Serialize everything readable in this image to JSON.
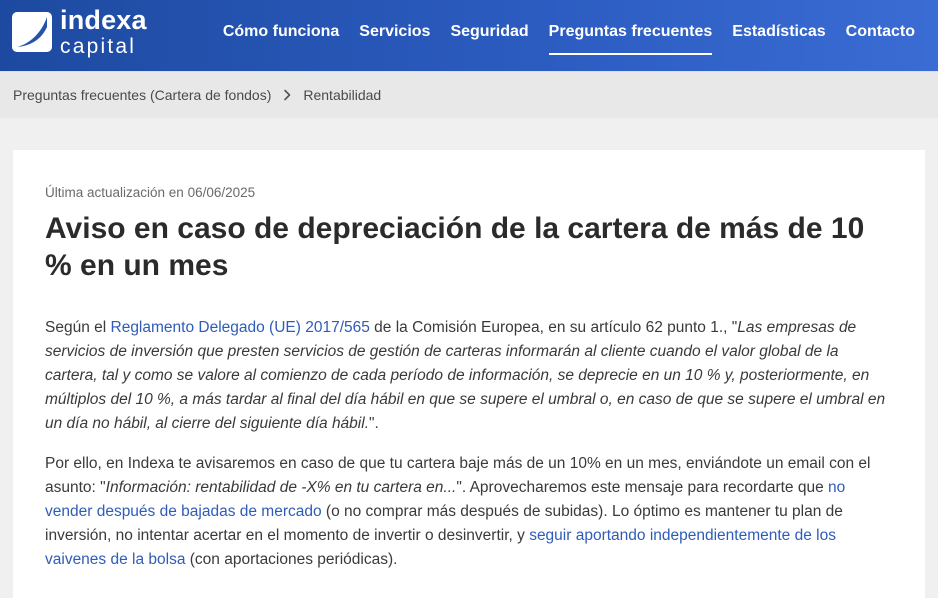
{
  "colors": {
    "header_start": "#1d4aa0",
    "header_mid": "#2b5bbf",
    "header_end": "#3a6cd4",
    "link": "#2e5cb8",
    "text": "#3a3a3a",
    "page_bg": "#f0f0f0",
    "breadcrumb_bg": "#e8e8e8"
  },
  "icons": {
    "logo": "indexa-logo-icon",
    "breadcrumb_separator": "chevron-right-icon"
  },
  "header": {
    "logo": {
      "line1": "indexa",
      "line2": "capital"
    },
    "nav": [
      {
        "label": "Cómo funciona",
        "active": false
      },
      {
        "label": "Servicios",
        "active": false
      },
      {
        "label": "Seguridad",
        "active": false
      },
      {
        "label": "Preguntas frecuentes",
        "active": true
      },
      {
        "label": "Estadísticas",
        "active": false
      },
      {
        "label": "Contacto",
        "active": false
      }
    ]
  },
  "breadcrumb": {
    "items": [
      "Preguntas frecuentes (Cartera de fondos)",
      "Rentabilidad"
    ]
  },
  "article": {
    "updated": "Última actualización en 06/06/2025",
    "title": "Aviso en caso de depreciación de la cartera de más de 10 % en un mes",
    "p1": [
      {
        "type": "text",
        "text": "Según el "
      },
      {
        "type": "link",
        "text": "Reglamento Delegado (UE) 2017/565"
      },
      {
        "type": "text",
        "text": " de la Comisión Europea, en su artículo 62 punto 1., \""
      },
      {
        "type": "italic",
        "text": "Las empresas de servicios de inversión que presten servicios de gestión de carteras informarán al cliente cuando el valor global de la cartera, tal y como se valore al comienzo de cada período de información, se deprecie en un 10 % y, posteriormente, en múltiplos del 10 %, a más tardar al final del día hábil en que se supere el umbral o, en caso de que se supere el umbral en un día no hábil, al cierre del siguiente día hábil."
      },
      {
        "type": "text",
        "text": "\"."
      }
    ],
    "p2": [
      {
        "type": "text",
        "text": "Por ello, en Indexa te avisaremos en caso de que tu cartera baje más de un 10% en un mes, enviándote un email con el asunto: \""
      },
      {
        "type": "italic",
        "text": "Información: rentabilidad de -X% en tu cartera en..."
      },
      {
        "type": "text",
        "text": "\". Aprovecharemos este mensaje para recordarte que "
      },
      {
        "type": "link",
        "text": "no vender después de bajadas de mercado"
      },
      {
        "type": "text",
        "text": " (o no comprar más después de subidas). Lo óptimo es mantener tu plan de inversión, no intentar acertar en el momento de invertir o desinvertir, y "
      },
      {
        "type": "link",
        "text": "seguir aportando independientemente de los vaivenes de la bolsa"
      },
      {
        "type": "text",
        "text": " (con aportaciones periódicas)."
      }
    ]
  }
}
